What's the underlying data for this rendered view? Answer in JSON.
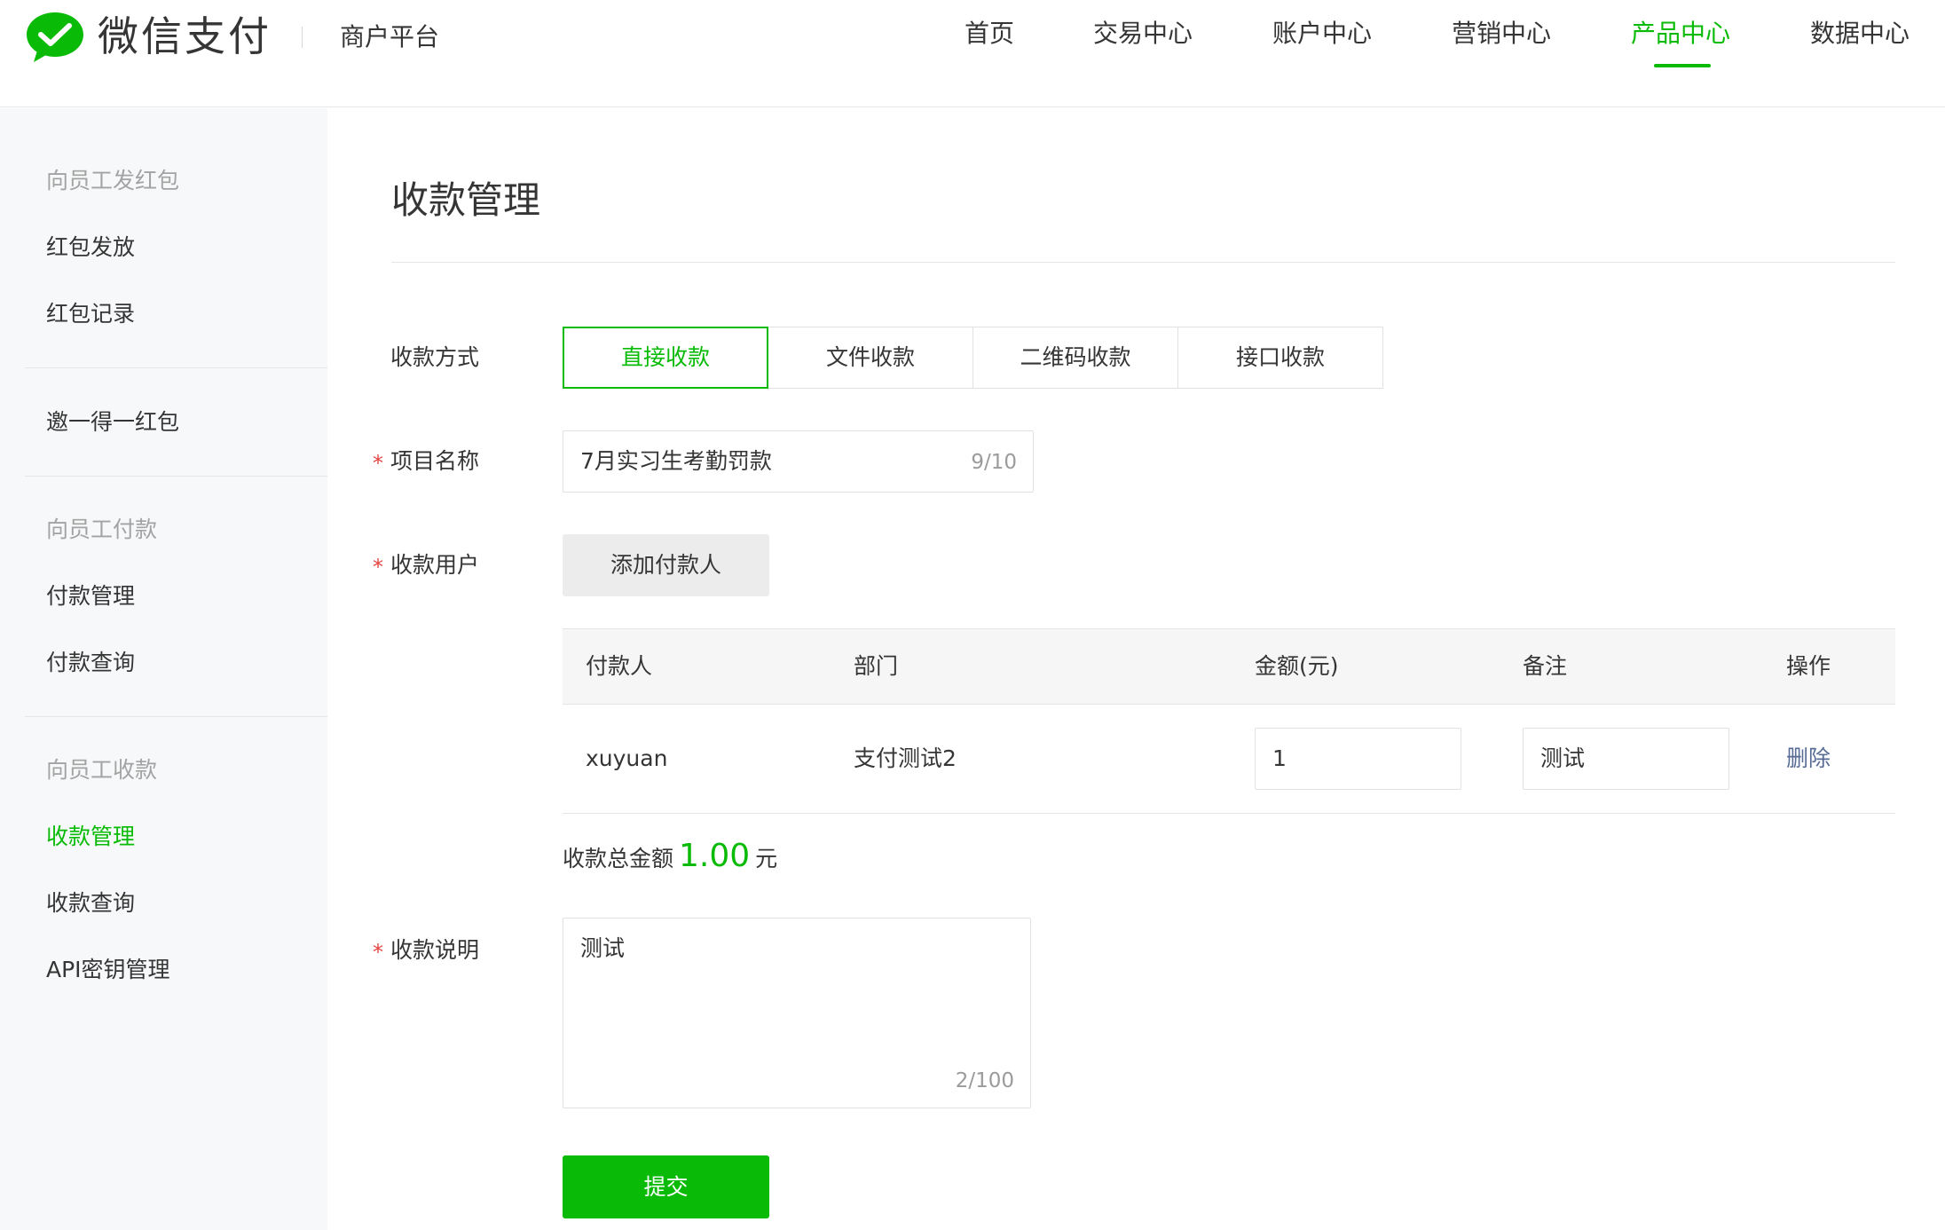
{
  "header": {
    "brand": "微信支付",
    "platform": "商户平台",
    "nav": [
      {
        "label": "首页"
      },
      {
        "label": "交易中心"
      },
      {
        "label": "账户中心"
      },
      {
        "label": "营销中心"
      },
      {
        "label": "产品中心",
        "active": true
      },
      {
        "label": "数据中心"
      }
    ]
  },
  "sidebar": {
    "groups": [
      {
        "title": "向员工发红包",
        "items": [
          "红包发放",
          "红包记录"
        ]
      },
      {
        "title": "",
        "items": [
          "邀一得一红包"
        ]
      },
      {
        "title": "向员工付款",
        "items": [
          "付款管理",
          "付款查询"
        ]
      },
      {
        "title": "向员工收款",
        "items": [
          "收款管理",
          "收款查询",
          "API密钥管理"
        ],
        "active": "收款管理"
      }
    ]
  },
  "main": {
    "title": "收款管理",
    "method_label": "收款方式",
    "methods": [
      "直接收款",
      "文件收款",
      "二维码收款",
      "接口收款"
    ],
    "active_method": "直接收款",
    "project_label": "项目名称",
    "project_value": "7月实习生考勤罚款",
    "project_count": "9/10",
    "users_label": "收款用户",
    "add_payer_label": "添加付款人",
    "table": {
      "headers": [
        "付款人",
        "部门",
        "金额(元)",
        "备注",
        "操作"
      ],
      "rows": [
        {
          "payer": "xuyuan",
          "dept": "支付测试2",
          "amount": "1",
          "note": "测试",
          "action": "删除"
        }
      ]
    },
    "total_label": "收款总金额",
    "total_amount": "1.00",
    "total_unit": "元",
    "desc_label": "收款说明",
    "desc_value": "测试",
    "desc_count": "2/100",
    "submit_label": "提交"
  },
  "colors": {
    "accent": "#09bb07",
    "link": "#576b95",
    "required": "#e64340"
  }
}
